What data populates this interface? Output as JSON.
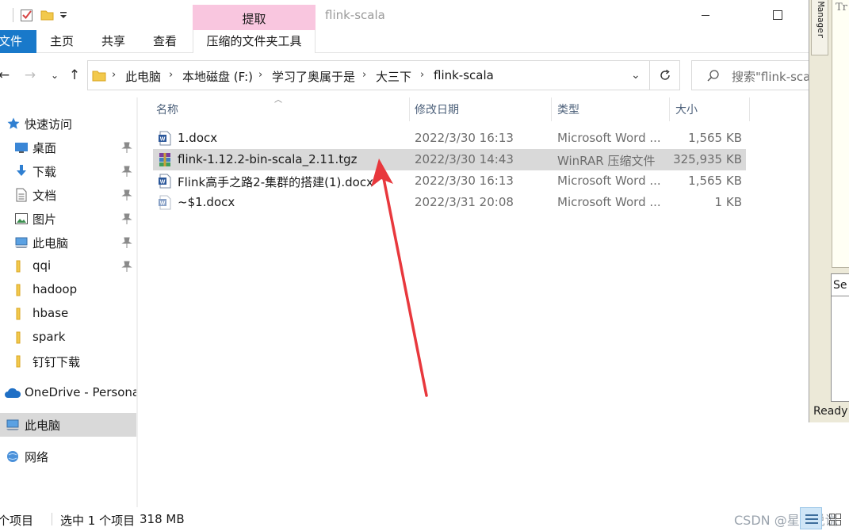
{
  "titlebar": {
    "contextual_tab": "提取",
    "window_title": "flink-scala"
  },
  "ribbon": {
    "tabs": [
      "文件",
      "主页",
      "共享",
      "查看"
    ],
    "contextual_tools": "压缩的文件夹工具"
  },
  "address": {
    "crumbs": [
      "此电脑",
      "本地磁盘 (F:)",
      "学习了奥属于是",
      "大三下",
      "flink-scala"
    ],
    "search_placeholder": "搜索\"flink-scala\""
  },
  "sidebar": {
    "items": [
      {
        "label": "快速访问",
        "icon": "star-icon",
        "pinned": false
      },
      {
        "label": "桌面",
        "icon": "desktop-icon",
        "pinned": true
      },
      {
        "label": "下载",
        "icon": "download-icon",
        "pinned": true
      },
      {
        "label": "文档",
        "icon": "document-icon",
        "pinned": true
      },
      {
        "label": "图片",
        "icon": "pictures-icon",
        "pinned": true
      },
      {
        "label": "此电脑",
        "icon": "computer-icon",
        "pinned": true
      },
      {
        "label": "qqi",
        "icon": "folder-icon",
        "pinned": true
      },
      {
        "label": "hadoop",
        "icon": "folder-icon",
        "pinned": false
      },
      {
        "label": "hbase",
        "icon": "folder-icon",
        "pinned": false
      },
      {
        "label": "spark",
        "icon": "folder-icon",
        "pinned": false
      },
      {
        "label": "钉钉下载",
        "icon": "folder-icon",
        "pinned": false
      },
      {
        "label": "OneDrive - Persona",
        "icon": "cloud-icon",
        "pinned": false
      },
      {
        "label": "此电脑",
        "icon": "computer-icon",
        "pinned": false,
        "selected": true
      },
      {
        "label": "网络",
        "icon": "network-icon",
        "pinned": false
      }
    ]
  },
  "columns": {
    "name": "名称",
    "date": "修改日期",
    "type": "类型",
    "size": "大小"
  },
  "files": [
    {
      "name": "1.docx",
      "date": "2022/3/30 16:13",
      "type": "Microsoft Word ...",
      "size": "1,565 KB",
      "icon": "word-document-icon"
    },
    {
      "name": "flink-1.12.2-bin-scala_2.11.tgz",
      "date": "2022/3/30 14:43",
      "type": "WinRAR 压缩文件",
      "size": "325,935 KB",
      "icon": "winrar-archive-icon",
      "selected": true
    },
    {
      "name": "Flink高手之路2-集群的搭建(1).docx",
      "date": "2022/3/30 16:13",
      "type": "Microsoft Word ...",
      "size": "1,565 KB",
      "icon": "word-document-icon"
    },
    {
      "name": "~$1.docx",
      "date": "2022/3/31 20:08",
      "type": "Microsoft Word ...",
      "size": "1 KB",
      "icon": "word-temp-icon"
    }
  ],
  "status": {
    "item_count": "个项目",
    "selection": "选中 1 个项目",
    "selection_size": "318 MB",
    "watermark": "CSDN @星铭说说"
  },
  "background_app": {
    "manager_tab": "Manager",
    "tr_text": "Tr",
    "se_text": "Se",
    "ready": "Ready"
  },
  "colors": {
    "file_tab": "#1979ca",
    "contextual_tab": "#f9c6df",
    "selection": "#d9d9d9",
    "annotation_arrow": "#e8383d"
  }
}
